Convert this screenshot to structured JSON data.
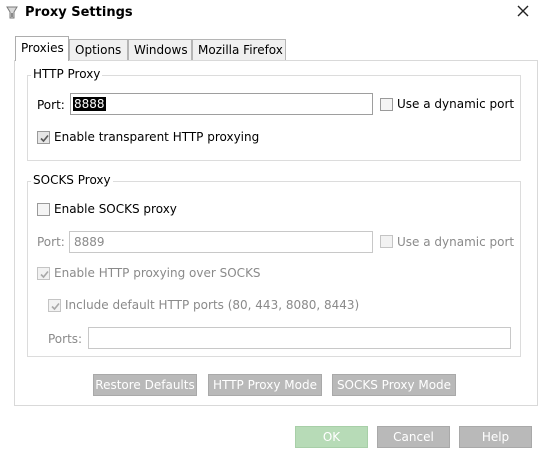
{
  "window": {
    "title": "Proxy Settings"
  },
  "tabs": [
    {
      "label": "Proxies",
      "active": true
    },
    {
      "label": "Options",
      "active": false
    },
    {
      "label": "Windows",
      "active": false
    },
    {
      "label": "Mozilla Firefox",
      "active": false
    }
  ],
  "http_proxy": {
    "group_label": "HTTP Proxy",
    "port_label": "Port:",
    "port_value": "8888",
    "dynamic_port_label": "Use a dynamic port",
    "dynamic_port_checked": false,
    "transparent_label": "Enable transparent HTTP proxying",
    "transparent_checked": true
  },
  "socks_proxy": {
    "group_label": "SOCKS Proxy",
    "enable_label": "Enable SOCKS proxy",
    "enable_checked": false,
    "port_label": "Port:",
    "port_value": "8889",
    "dynamic_port_label": "Use a dynamic port",
    "http_over_socks_label": "Enable HTTP proxying over SOCKS",
    "include_ports_label": "Include default HTTP ports (80, 443, 8080, 8443)",
    "ports_label": "Ports:",
    "ports_value": ""
  },
  "mode_buttons": {
    "restore_defaults": "Restore Defaults",
    "http_mode": "HTTP Proxy Mode",
    "socks_mode": "SOCKS Proxy Mode"
  },
  "dialog_buttons": {
    "ok": "OK",
    "cancel": "Cancel",
    "help": "Help"
  },
  "colors": {
    "button_gray": "#b9b9b9",
    "button_ok": "#b7dbb7",
    "selection": "#000000"
  }
}
